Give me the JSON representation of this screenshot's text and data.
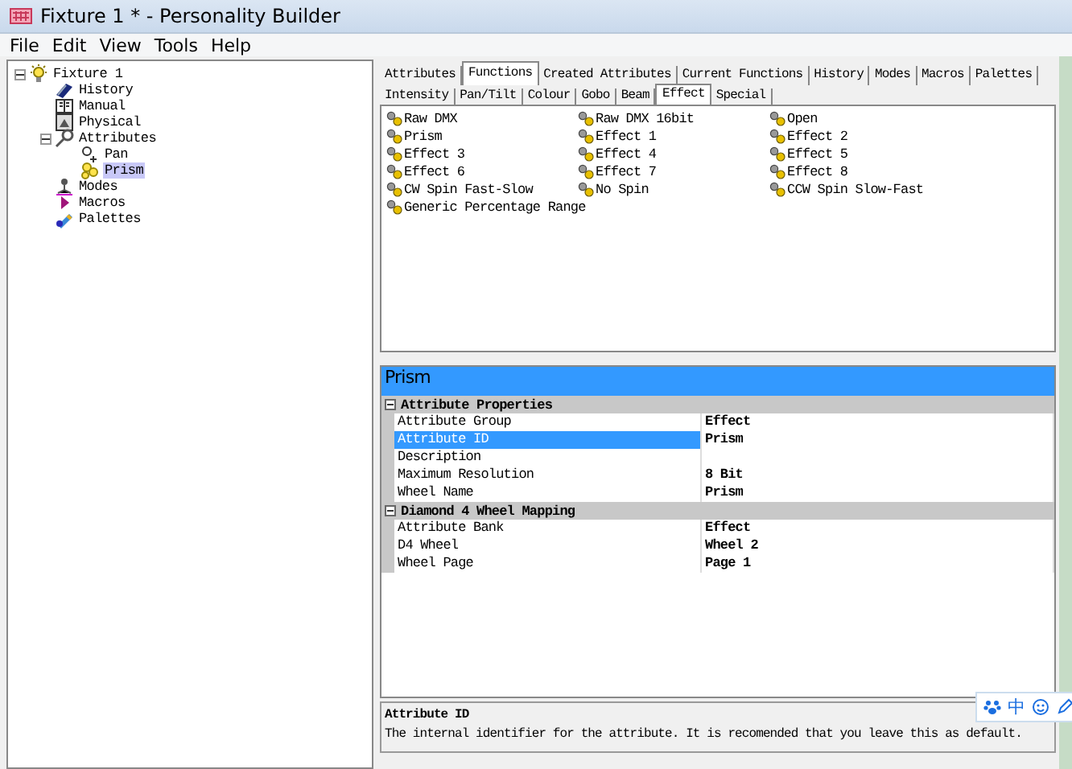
{
  "window": {
    "title": "Fixture 1 * - Personality Builder"
  },
  "menu": [
    "File",
    "Edit",
    "View",
    "Tools",
    "Help"
  ],
  "tree": [
    {
      "label": "Fixture 1",
      "kind": "fixture",
      "expanded": true,
      "selected": false,
      "children": [
        {
          "label": "History",
          "kind": "history",
          "selected": false
        },
        {
          "label": "Manual",
          "kind": "manual",
          "selected": false
        },
        {
          "label": "Physical",
          "kind": "physical",
          "selected": false
        },
        {
          "label": "Attributes",
          "kind": "attributes",
          "expanded": true,
          "selected": false,
          "children": [
            {
              "label": "Pan",
              "kind": "pan",
              "selected": false
            },
            {
              "label": "Prism",
              "kind": "prism",
              "selected": true
            }
          ]
        },
        {
          "label": "Modes",
          "kind": "modes",
          "selected": false
        },
        {
          "label": "Macros",
          "kind": "macros",
          "selected": false
        },
        {
          "label": "Palettes",
          "kind": "palettes",
          "selected": false
        }
      ]
    }
  ],
  "main_tabs": [
    {
      "label": "Attributes",
      "selected": false
    },
    {
      "label": "Functions",
      "selected": true
    },
    {
      "label": "Created Attributes",
      "selected": false
    },
    {
      "label": "Current Functions",
      "selected": false
    },
    {
      "label": "History",
      "selected": false
    },
    {
      "label": "Modes",
      "selected": false
    },
    {
      "label": "Macros",
      "selected": false
    },
    {
      "label": "Palettes",
      "selected": false
    }
  ],
  "group_tabs": [
    {
      "label": "Intensity",
      "selected": false
    },
    {
      "label": "Pan/Tilt",
      "selected": false
    },
    {
      "label": "Colour",
      "selected": false
    },
    {
      "label": "Gobo",
      "selected": false
    },
    {
      "label": "Beam",
      "selected": false
    },
    {
      "label": "Effect",
      "selected": true
    },
    {
      "label": "Special",
      "selected": false
    }
  ],
  "functions": [
    "Raw DMX",
    "Raw DMX 16bit",
    "Open",
    "Prism",
    "Effect 1",
    "Effect 2",
    "Effect 3",
    "Effect 4",
    "Effect 5",
    "Effect 6",
    "Effect 7",
    "Effect 8",
    "CW Spin Fast-Slow",
    "No Spin",
    "CCW Spin Slow-Fast",
    "Generic Percentage Range"
  ],
  "properties": {
    "title": "Prism",
    "sections": [
      {
        "name": "Attribute Properties",
        "expanded": true,
        "rows": [
          {
            "name": "Attribute Group",
            "value": "Effect",
            "selected": false
          },
          {
            "name": "Attribute ID",
            "value": "Prism",
            "selected": true
          },
          {
            "name": "Description",
            "value": "",
            "selected": false
          },
          {
            "name": "Maximum Resolution",
            "value": "8 Bit",
            "selected": false
          },
          {
            "name": "Wheel Name",
            "value": "Prism",
            "selected": false
          }
        ]
      },
      {
        "name": "Diamond 4 Wheel Mapping",
        "expanded": true,
        "rows": [
          {
            "name": "Attribute Bank",
            "value": "Effect",
            "selected": false
          },
          {
            "name": "D4 Wheel",
            "value": "Wheel 2",
            "selected": false
          },
          {
            "name": "Wheel Page",
            "value": "Page 1",
            "selected": false
          }
        ]
      }
    ]
  },
  "help": {
    "title": "Attribute ID",
    "text": "The internal identifier for the attribute. It is recomended that you leave this as default."
  },
  "ime_toolbar": {
    "label": "中"
  }
}
